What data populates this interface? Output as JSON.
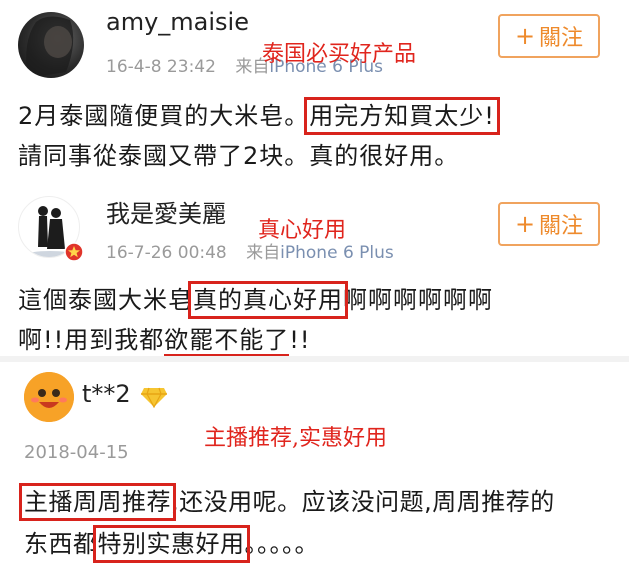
{
  "post1": {
    "username": "amy_maisie",
    "time": "16-4-8 23:42",
    "source_prefix": "来自",
    "device": "iPhone 6 Plus",
    "follow_label": "關注",
    "annotation": "泰国必买好产品",
    "line1_a": "2月泰國隨便買的大米皂。",
    "line1_b": "用完方知買太少!",
    "line2": "請同事從泰國又帶了2块。真的很好用。"
  },
  "post2": {
    "username": "我是愛美麗",
    "time": "16-7-26 00:48",
    "source_prefix": "来自",
    "device": "iPhone 6 Plus",
    "follow_label": "關注",
    "annotation": "真心好用",
    "line1_a": "這個泰國大米皂",
    "line1_b": "真的真心好用",
    "line1_c": "啊啊啊啊啊啊",
    "line2_a": "啊!!用到我都",
    "line2_b": "欲罷不能了",
    "line2_c": "!!"
  },
  "post3": {
    "username": "t**2",
    "date": "2018-04-15",
    "annotation": "主播推荐,实惠好用",
    "line1_a": "主播周周推荐",
    "line1_b": ",还没用呢。应该没问题,周周推荐的",
    "line2_a": "东西都",
    "line2_b": "特别实惠好用",
    "line2_c": "。。。。。"
  },
  "icons": {
    "plus": "+",
    "diamond": "diamond-icon"
  },
  "colors": {
    "accent_orange": "#ee8a2c",
    "highlight_red": "#d8231c",
    "meta_gray": "#9a9a9a"
  }
}
